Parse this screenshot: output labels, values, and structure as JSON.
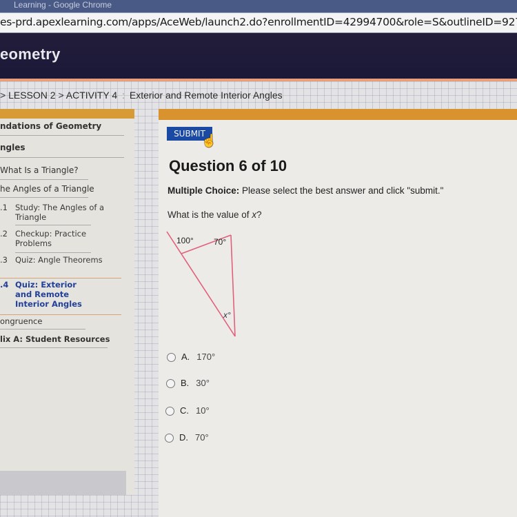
{
  "browser": {
    "window_title": "Learning - Google Chrome",
    "url": "es-prd.apexlearning.com/apps/AceWeb/launch2.do?enrollmentID=42994700&role=S&outlineID=9272601"
  },
  "course": {
    "title": "eometry"
  },
  "breadcrumb": {
    "prefix": ">",
    "lesson": "LESSON 2",
    "sep": ">",
    "activity": "ACTIVITY 4",
    "colon": ":",
    "activity_title": "Exterior and Remote Interior Angles"
  },
  "sidebar": {
    "unit": "ndations of Geometry",
    "section": "ngles",
    "lessons": [
      {
        "label": "What Is a Triangle?"
      },
      {
        "label": "he Angles of a Triangle"
      }
    ],
    "activities": [
      {
        "num": ".1",
        "label": "Study: The Angles of a Triangle",
        "active": false
      },
      {
        "num": ".2",
        "label": "Checkup: Practice Problems",
        "active": false
      },
      {
        "num": ".3",
        "label": "Quiz: Angle Theorems",
        "active": false
      },
      {
        "num": ".4",
        "label": "Quiz: Exterior and Remote Interior Angles",
        "active": true
      }
    ],
    "after": [
      {
        "label": "ongruence",
        "bold": false
      },
      {
        "label": "lix A: Student Resources",
        "bold": true
      }
    ]
  },
  "question": {
    "submit_label": "SUBMIT",
    "title": "Question 6 of 10",
    "instruction_label": "Multiple Choice:",
    "instruction_text": " Please select the best answer and click \"submit.\"",
    "prompt_pre": "What is the value of ",
    "prompt_var": "x",
    "prompt_post": "?",
    "figure": {
      "exterior_angle": "100°",
      "interior_angle": "70°",
      "unknown_angle": "x°",
      "line_color": "#e0607a"
    },
    "choices": [
      {
        "letter": "A.",
        "value": "170°"
      },
      {
        "letter": "B.",
        "value": "30°"
      },
      {
        "letter": "C.",
        "value": "10°"
      },
      {
        "letter": "D.",
        "value": "70°"
      }
    ]
  }
}
